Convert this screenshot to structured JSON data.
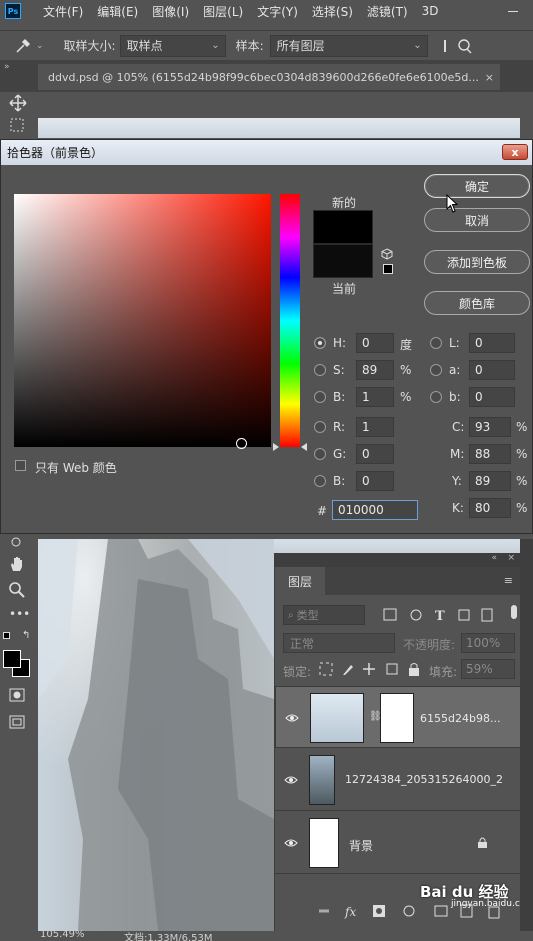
{
  "menubar": {
    "logo": "Ps",
    "items": [
      "文件(F)",
      "编辑(E)",
      "图像(I)",
      "图层(L)",
      "文字(Y)",
      "选择(S)",
      "滤镜(T)",
      "3D"
    ]
  },
  "options": {
    "sample_size_label": "取样大小:",
    "sample_size_value": "取样点",
    "sample_label": "样本:",
    "sample_value": "所有图层"
  },
  "document": {
    "tab_title": "ddvd.psd @ 105% (6155d24b98f99c6bec0304d839600d266e0fe6e6100e5d..."
  },
  "color_picker": {
    "title": "拾色器（前景色）",
    "close_glyph": "x",
    "new_label": "新的",
    "current_label": "当前",
    "buttons": {
      "ok": "确定",
      "cancel": "取消",
      "add_swatch": "添加到色板",
      "libraries": "颜色库"
    },
    "web_only_label": "只有 Web 颜色",
    "hsb": [
      {
        "label": "H:",
        "value": "0",
        "unit": "度",
        "selected": true
      },
      {
        "label": "S:",
        "value": "89",
        "unit": "%",
        "selected": false
      },
      {
        "label": "B:",
        "value": "1",
        "unit": "%",
        "selected": false
      }
    ],
    "rgb": [
      {
        "label": "R:",
        "value": "1"
      },
      {
        "label": "G:",
        "value": "0"
      },
      {
        "label": "B:",
        "value": "0"
      }
    ],
    "lab": [
      {
        "label": "L:",
        "value": "0"
      },
      {
        "label": "a:",
        "value": "0"
      },
      {
        "label": "b:",
        "value": "0"
      }
    ],
    "cmyk": [
      {
        "label": "C:",
        "value": "93",
        "unit": "%"
      },
      {
        "label": "M:",
        "value": "88",
        "unit": "%"
      },
      {
        "label": "Y:",
        "value": "89",
        "unit": "%"
      },
      {
        "label": "K:",
        "value": "80",
        "unit": "%"
      }
    ],
    "hex_label": "#",
    "hex_value": "010000",
    "new_color": "#010000",
    "current_color": "#0c0c0c"
  },
  "layers_panel": {
    "tab": "图层",
    "filter_kind": "类型",
    "blend_mode": "正常",
    "opacity_label": "不透明度:",
    "opacity_value": "100%",
    "lock_label": "锁定:",
    "fill_label": "填充:",
    "fill_value": "59%",
    "layers": [
      {
        "name": "6155d24b98...",
        "selected": true
      },
      {
        "name": "12724384_205315264000_2",
        "selected": false
      },
      {
        "name": "背景",
        "selected": false
      }
    ]
  },
  "status": {
    "zoom": "105.49%",
    "doc": "文档:1.33M/6.53M"
  },
  "watermark": {
    "brand": "Bai du 经验",
    "url": "jingyan.baidu.com"
  }
}
